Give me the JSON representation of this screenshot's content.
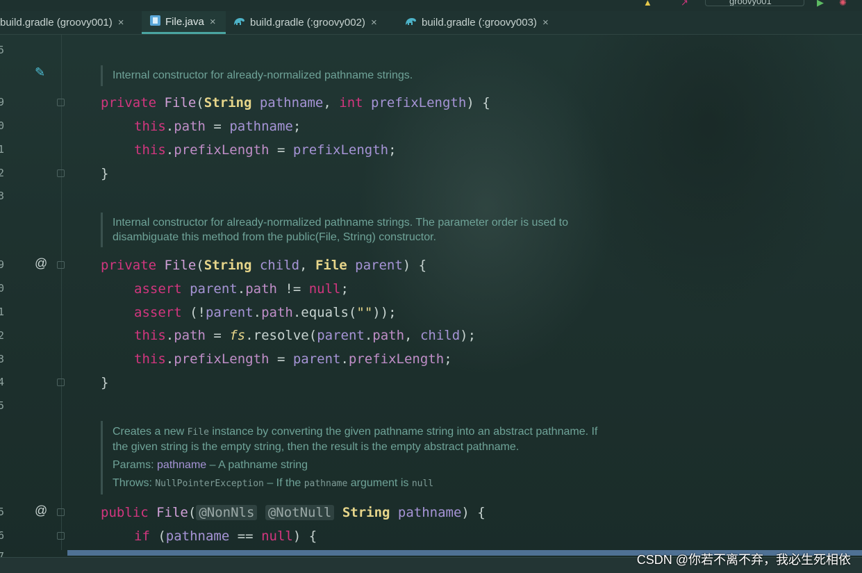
{
  "run_config": {
    "label": "groovy001"
  },
  "tabs": [
    {
      "label": "build.gradle (groovy001)",
      "icon": "gradle-icon",
      "active": false
    },
    {
      "label": "File.java",
      "icon": "java-file-icon",
      "active": true
    },
    {
      "label": "build.gradle (:groovy002)",
      "icon": "gradle-icon",
      "active": false
    },
    {
      "label": "build.gradle (:groovy003)",
      "icon": "gradle-icon",
      "active": false
    }
  ],
  "tab_close_glyph": "×",
  "line_numbers": [
    "5",
    "9",
    "0",
    "1",
    "2",
    "3",
    "9",
    "0",
    "1",
    "2",
    "3",
    "4",
    "5",
    "5",
    "6",
    "7"
  ],
  "docs": {
    "doc1": "Internal constructor for already-normalized pathname strings.",
    "doc2_line1": "Internal constructor for already-normalized pathname strings. The parameter order is used to",
    "doc2_line2": "disambiguate this method from the public(File, String) constructor.",
    "doc3_pre": "Creates a new ",
    "doc3_code": "File",
    "doc3_post": " instance by converting the given pathname string into an abstract pathname. If",
    "doc3_line2": "the given string is the empty string, then the result is the empty abstract pathname.",
    "params_label": "Params: ",
    "params_name": "pathname",
    "params_desc": " – A pathname string",
    "throws_label": "Throws: ",
    "throws_exc": "NullPointerException",
    "throws_mid": " – If the ",
    "throws_arg": "pathname",
    "throws_post": " argument is ",
    "throws_null": "null"
  },
  "code": {
    "private": "private",
    "public": "public",
    "File": "File",
    "String": "String",
    "int": "int",
    "this": "this",
    "assert": "assert",
    "null": "null",
    "if": "if",
    "pathname": "pathname",
    "prefixLength": "prefixLength",
    "child": "child",
    "parent": "parent",
    "path": "path",
    "fs": "fs",
    "resolve": "resolve",
    "equals": "equals",
    "empty_string": "\"\"",
    "nonnls": "@NonNls",
    "notnull": "@NotNull"
  },
  "watermark": "CSDN @你若不离不弃，我必生死相依",
  "colors": {
    "keyword": "#d2367f",
    "type": "#e6d58a",
    "field": "#c08ec8",
    "param": "#a694d6",
    "doc": "#6fa398",
    "active_tab_underline": "#4aa5a1"
  }
}
